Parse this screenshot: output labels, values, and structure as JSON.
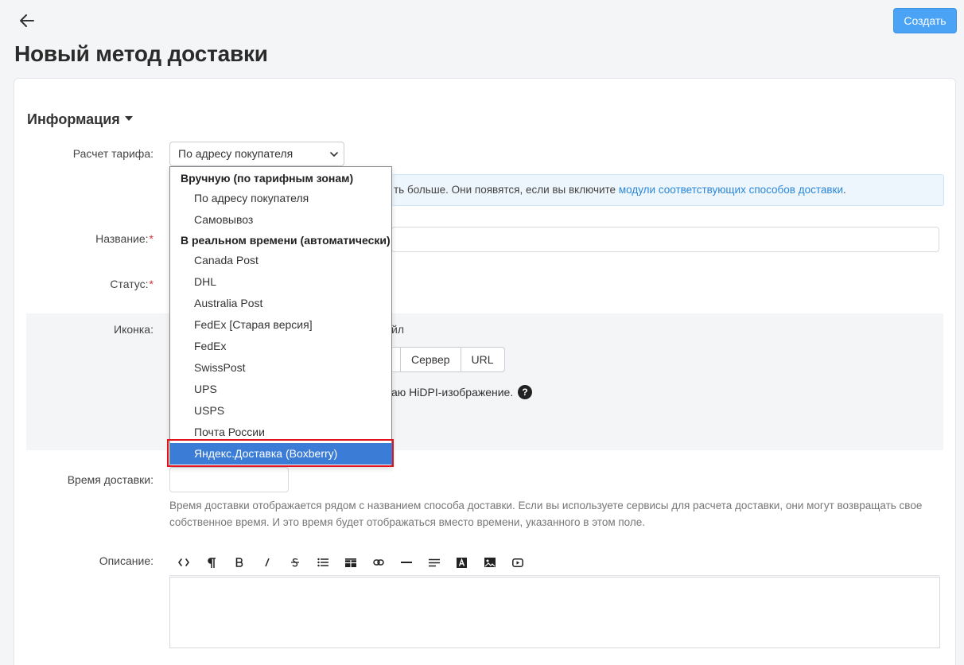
{
  "header": {
    "back_icon": "arrow-left-icon",
    "create_label": "Создать",
    "title": "Новый метод доставки"
  },
  "section": {
    "title": "Информация"
  },
  "form": {
    "rate_calc_label": "Расчет тарифа:",
    "rate_calc_value": "По адресу покупателя",
    "info_text": "ть больше. Они появятся, если вы включите ",
    "info_link": "модули соответствующих способов доставки",
    "info_end": ".",
    "name_label": "Название:",
    "status_label": "Статус:",
    "icon_label": "Иконка:",
    "icon_file_text": "йл",
    "icon_tabs": [
      "",
      "Сервер",
      "URL"
    ],
    "hidpi_text": "аю HiDPI-изображение.",
    "delivery_time_label": "Время доставки:",
    "delivery_time_help": "Время доставки отображается рядом с названием способа доставки. Если вы используете сервисы для расчета доставки, они могут возвращать свое собственное время. И это время будет отображаться вместо времени, указанного в этом поле.",
    "description_label": "Описание:",
    "required_mark": "*"
  },
  "editor": {
    "toolbar": [
      "html-code-icon",
      "paragraph-icon",
      "bold-icon",
      "italic-icon",
      "strikethrough-icon",
      "unordered-list-icon",
      "table-icon",
      "link-icon",
      "horizontal-rule-icon",
      "align-icon",
      "text-color-icon",
      "image-icon",
      "video-icon"
    ]
  },
  "dropdown": {
    "group1": "Вручную (по тарифным зонам)",
    "group1_options": [
      "По адресу покупателя",
      "Самовывоз"
    ],
    "group2": "В реальном времени (автоматически)",
    "group2_options": [
      "Canada Post",
      "DHL",
      "Australia Post",
      "FedEx [Старая версия]",
      "FedEx",
      "SwissPost",
      "UPS",
      "USPS",
      "Почта России"
    ],
    "selected": "Яндекс.Доставка (Boxberry)"
  },
  "colors": {
    "accent": "#4aa3f5",
    "link": "#2a86d8",
    "selected_bg": "#3a7cd6",
    "highlight_border": "#e0131c",
    "required": "#d9343a"
  }
}
